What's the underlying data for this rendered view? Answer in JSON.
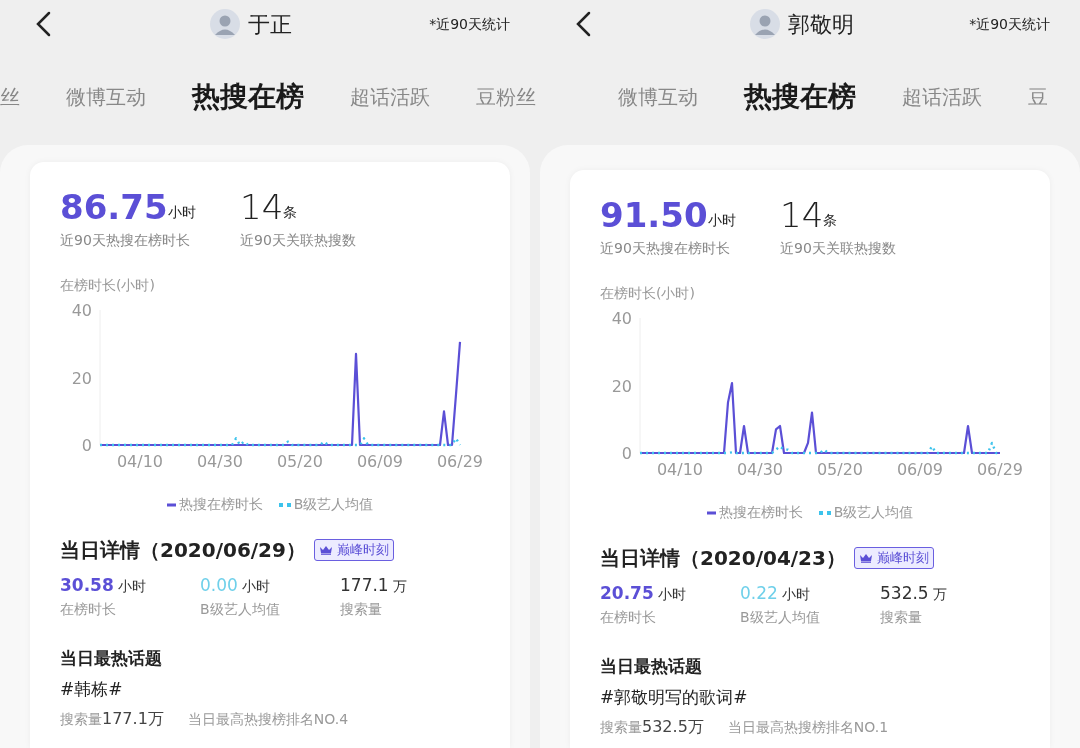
{
  "panels": [
    {
      "header": {
        "name": "于正",
        "note": "*近90天统计"
      },
      "tabs": [
        {
          "label": "丝",
          "selected": false
        },
        {
          "label": "微博互动",
          "selected": false
        },
        {
          "label": "热搜在榜",
          "selected": true
        },
        {
          "label": "超话活跃",
          "selected": false
        },
        {
          "label": "豆粉丝",
          "selected": false
        }
      ],
      "summary": [
        {
          "kind": "accent",
          "value": "86.75",
          "unit": "小时",
          "label": "近90天热搜在榜时长"
        },
        {
          "kind": "plain",
          "value": "14",
          "unit": "条",
          "label": "近90天关联热搜数"
        }
      ],
      "chart_data": {
        "type": "line",
        "legend": "bottom",
        "ylabel": "在榜时长(小时)",
        "ylim": [
          0,
          40
        ],
        "yticks": [
          0,
          20,
          40
        ],
        "categories": [
          null,
          null,
          null,
          null,
          null,
          null,
          null,
          null,
          null,
          null,
          "04/10",
          null,
          null,
          null,
          null,
          null,
          null,
          null,
          null,
          null,
          null,
          null,
          null,
          null,
          null,
          null,
          null,
          null,
          null,
          null,
          "04/30",
          null,
          null,
          null,
          null,
          null,
          null,
          null,
          null,
          null,
          null,
          null,
          null,
          null,
          null,
          null,
          null,
          null,
          null,
          null,
          "05/20",
          null,
          null,
          null,
          null,
          null,
          null,
          null,
          null,
          null,
          null,
          null,
          null,
          null,
          null,
          null,
          null,
          null,
          null,
          null,
          "06/09",
          null,
          null,
          null,
          null,
          null,
          null,
          null,
          null,
          null,
          null,
          null,
          null,
          null,
          null,
          null,
          null,
          null,
          null,
          null,
          "06/29"
        ],
        "series": [
          {
            "name": "热搜在榜时长",
            "color": "#5b4fd6",
            "line_style": "solid",
            "values": [
              0,
              0,
              0,
              0,
              0,
              0,
              0,
              0,
              0,
              0,
              0,
              0,
              0,
              0,
              0,
              0,
              0,
              0,
              0,
              0,
              0,
              0,
              0,
              0,
              0,
              0,
              0,
              0,
              0,
              0,
              0,
              0,
              0,
              0,
              0,
              0,
              0,
              0,
              0,
              0,
              0,
              0,
              0,
              0,
              0,
              0,
              0,
              0,
              0,
              0,
              0,
              0,
              0,
              0,
              0,
              0,
              0,
              0,
              0,
              0,
              0,
              0,
              0,
              0,
              27,
              0,
              0,
              0,
              0,
              0,
              0,
              0,
              0,
              0,
              0,
              0,
              0,
              0,
              0,
              0,
              0,
              0,
              0,
              0,
              0,
              0,
              10,
              0,
              0,
              15,
              30.58
            ]
          },
          {
            "name": "B级艺人均值",
            "color": "#3cc3ec",
            "line_style": "dotted",
            "values": [
              0,
              0,
              0,
              0,
              0,
              0,
              0,
              0,
              0,
              0,
              0,
              0,
              0,
              0,
              0,
              0,
              0,
              0,
              0,
              0,
              0,
              0,
              0,
              0,
              0,
              0,
              0,
              0,
              0,
              0,
              0,
              0,
              0,
              0,
              2,
              0,
              1,
              0,
              0,
              0,
              0,
              0,
              0,
              0,
              0,
              0,
              0,
              1,
              0,
              0,
              0,
              0,
              0,
              0,
              0,
              0,
              1,
              0,
              0,
              0,
              0,
              0,
              0,
              0,
              0,
              0,
              2,
              0,
              0,
              0,
              0,
              0,
              0,
              0,
              0,
              0,
              0,
              0,
              0,
              0,
              0,
              0,
              0,
              0,
              0,
              0,
              0,
              0,
              0,
              2,
              0
            ]
          }
        ]
      },
      "detail": {
        "title": "当日详情（2020/06/29）",
        "badge": "巅峰时刻",
        "stats": [
          {
            "kind": "primary",
            "value": "30.58",
            "unit": "小时",
            "label": "在榜时长"
          },
          {
            "kind": "average",
            "value": "0.00",
            "unit": "小时",
            "label": "B级艺人均值"
          },
          {
            "kind": "plain",
            "value": "177.1",
            "unit": "万",
            "label": "搜索量"
          }
        ]
      },
      "topic": {
        "heading": "当日最热话题",
        "name": "#韩栋#",
        "volume_label": "搜索量",
        "volume_value": "177.1万",
        "rank": "当日最高热搜榜排名NO.4"
      }
    },
    {
      "header": {
        "name": "郭敬明",
        "note": "*近90天统计"
      },
      "tabs": [
        {
          "label": "微博互动",
          "selected": false
        },
        {
          "label": "热搜在榜",
          "selected": true
        },
        {
          "label": "超话活跃",
          "selected": false
        },
        {
          "label": "豆",
          "selected": false
        }
      ],
      "summary": [
        {
          "kind": "accent",
          "value": "91.50",
          "unit": "小时",
          "label": "近90天热搜在榜时长"
        },
        {
          "kind": "plain",
          "value": "14",
          "unit": "条",
          "label": "近90天关联热搜数"
        }
      ],
      "chart_data": {
        "type": "line",
        "legend": "bottom",
        "ylabel": "在榜时长(小时)",
        "ylim": [
          0,
          40
        ],
        "yticks": [
          0,
          20,
          40
        ],
        "categories": [
          null,
          null,
          null,
          null,
          null,
          null,
          null,
          null,
          null,
          null,
          "04/10",
          null,
          null,
          null,
          null,
          null,
          null,
          null,
          null,
          null,
          null,
          null,
          null,
          null,
          null,
          null,
          null,
          null,
          null,
          null,
          "04/30",
          null,
          null,
          null,
          null,
          null,
          null,
          null,
          null,
          null,
          null,
          null,
          null,
          null,
          null,
          null,
          null,
          null,
          null,
          null,
          "05/20",
          null,
          null,
          null,
          null,
          null,
          null,
          null,
          null,
          null,
          null,
          null,
          null,
          null,
          null,
          null,
          null,
          null,
          null,
          null,
          "06/09",
          null,
          null,
          null,
          null,
          null,
          null,
          null,
          null,
          null,
          null,
          null,
          null,
          null,
          null,
          null,
          null,
          null,
          null,
          null,
          "06/29"
        ],
        "series": [
          {
            "name": "热搜在榜时长",
            "color": "#5b4fd6",
            "line_style": "solid",
            "values": [
              0,
              0,
              0,
              0,
              0,
              0,
              0,
              0,
              0,
              0,
              0,
              0,
              0,
              0,
              0,
              0,
              0,
              0,
              0,
              0,
              0,
              0,
              15,
              20.75,
              0,
              0,
              8,
              0,
              0,
              0,
              0,
              0,
              0,
              0,
              7,
              8,
              0,
              0,
              0,
              0,
              0,
              0,
              3,
              12,
              0,
              0,
              0,
              0,
              0,
              0,
              0,
              0,
              0,
              0,
              0,
              0,
              0,
              0,
              0,
              0,
              0,
              0,
              0,
              0,
              0,
              0,
              0,
              0,
              0,
              0,
              0,
              0,
              0,
              0,
              0,
              0,
              0,
              0,
              0,
              0,
              0,
              0,
              8,
              0,
              0,
              0,
              0,
              0,
              0,
              0,
              0
            ]
          },
          {
            "name": "B级艺人均值",
            "color": "#3cc3ec",
            "line_style": "dotted",
            "values": [
              0,
              0,
              0,
              0,
              0,
              0,
              0,
              0,
              0,
              0,
              0,
              0,
              0,
              0,
              0,
              0,
              0,
              0,
              0,
              0,
              0,
              0,
              0,
              0.22,
              0,
              0,
              0,
              0,
              0,
              0,
              0,
              0,
              0,
              0,
              1,
              2,
              1,
              1,
              0,
              0,
              0,
              0,
              0,
              0,
              0,
              0,
              1,
              0,
              0,
              0,
              0,
              0,
              0,
              0,
              0,
              0,
              0,
              0,
              0,
              0,
              0,
              0,
              0,
              0,
              0,
              0,
              0,
              0,
              0,
              0,
              0,
              0,
              0,
              2,
              0,
              0,
              0,
              0,
              0,
              0,
              0,
              0,
              0,
              0,
              0,
              0,
              0,
              0,
              3,
              0,
              0
            ]
          }
        ]
      },
      "detail": {
        "title": "当日详情（2020/04/23）",
        "badge": "巅峰时刻",
        "stats": [
          {
            "kind": "primary",
            "value": "20.75",
            "unit": "小时",
            "label": "在榜时长"
          },
          {
            "kind": "average",
            "value": "0.22",
            "unit": "小时",
            "label": "B级艺人均值"
          },
          {
            "kind": "plain",
            "value": "532.5",
            "unit": "万",
            "label": "搜索量"
          }
        ]
      },
      "topic": {
        "heading": "当日最热话题",
        "name": "#郭敬明写的歌词#",
        "volume_label": "搜索量",
        "volume_value": "532.5万",
        "rank": "当日最高热搜榜排名NO.1"
      }
    }
  ]
}
